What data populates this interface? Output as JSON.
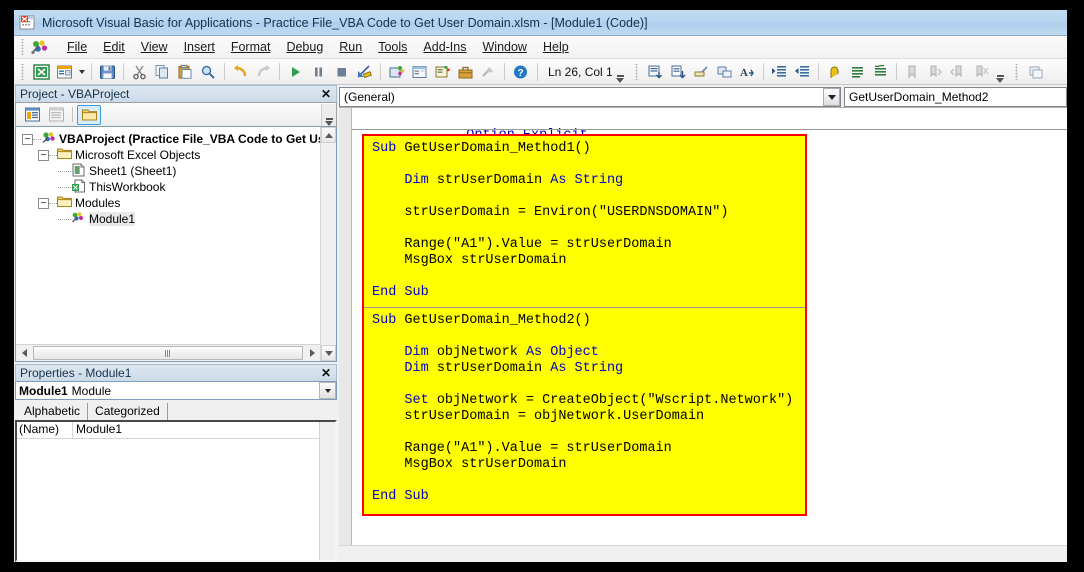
{
  "window": {
    "title": "Microsoft Visual Basic for Applications - Practice File_VBA Code to Get User Domain.xlsm - [Module1 (Code)]",
    "app_icon": "vba-excel-icon"
  },
  "menu": {
    "items": [
      {
        "label": "File",
        "accel": "F"
      },
      {
        "label": "Edit",
        "accel": "E"
      },
      {
        "label": "View",
        "accel": "V"
      },
      {
        "label": "Insert",
        "accel": "I"
      },
      {
        "label": "Format",
        "accel": "o"
      },
      {
        "label": "Debug",
        "accel": "D"
      },
      {
        "label": "Run",
        "accel": "R"
      },
      {
        "label": "Tools",
        "accel": "T"
      },
      {
        "label": "Add-Ins",
        "accel": "A"
      },
      {
        "label": "Window",
        "accel": "W"
      },
      {
        "label": "Help",
        "accel": "H"
      }
    ]
  },
  "toolbar": {
    "buttons": [
      "view-excel-icon",
      "insert-userform-icon",
      "save-icon",
      "cut-icon",
      "copy-icon",
      "paste-icon",
      "find-icon",
      "undo-icon",
      "redo-icon",
      "run-icon",
      "break-icon",
      "reset-icon",
      "design-mode-icon",
      "project-explorer-icon",
      "properties-window-icon",
      "object-browser-icon",
      "toolbox-icon",
      "help-icon"
    ],
    "status_text": "Ln 26, Col 1",
    "edit_buttons": [
      "list-properties-icon",
      "list-constants-icon",
      "quick-info-icon",
      "parameter-info-icon",
      "complete-word-icon",
      "indent-icon",
      "outdent-icon",
      "toggle-breakpoint-icon",
      "comment-block-icon",
      "uncomment-block-icon",
      "toggle-bookmark-icon",
      "next-bookmark-icon",
      "previous-bookmark-icon",
      "clear-bookmarks-icon"
    ]
  },
  "project_panel": {
    "caption": "Project - VBAProject",
    "close_label": "✕",
    "toolbar_buttons": [
      "view-code-icon",
      "view-object-icon",
      "toggle-folders-icon"
    ],
    "tree": [
      {
        "level": 0,
        "label": "VBAProject (Practice File_VBA Code to Get User I",
        "icon": "project-icon",
        "bold": true,
        "expander": "−",
        "selected": false
      },
      {
        "level": 1,
        "label": "Microsoft Excel Objects",
        "icon": "folder-icon",
        "bold": false,
        "expander": "−",
        "selected": false
      },
      {
        "level": 2,
        "label": "Sheet1 (Sheet1)",
        "icon": "worksheet-icon",
        "bold": false,
        "expander": "",
        "selected": false
      },
      {
        "level": 2,
        "label": "ThisWorkbook",
        "icon": "workbook-icon",
        "bold": false,
        "expander": "",
        "selected": false
      },
      {
        "level": 1,
        "label": "Modules",
        "icon": "folder-icon",
        "bold": false,
        "expander": "−",
        "selected": false
      },
      {
        "level": 2,
        "label": "Module1",
        "icon": "module-icon",
        "bold": false,
        "expander": "",
        "selected": true
      }
    ]
  },
  "properties_panel": {
    "caption": "Properties - Module1",
    "close_label": "✕",
    "object_name": "Module1",
    "object_type": "Module",
    "tabs": [
      {
        "label": "Alphabetic",
        "active": true
      },
      {
        "label": "Categorized",
        "active": false
      }
    ],
    "rows": [
      {
        "key": "(Name)",
        "value": "Module1"
      }
    ]
  },
  "code_window": {
    "object_combo": "(General)",
    "procedure_combo": "GetUserDomain_Method2",
    "header_lines": [
      [
        {
          "t": "Option Explicit",
          "k": true
        }
      ]
    ],
    "highlight": {
      "border_color": "#ff0000",
      "background_color": "#ffff00",
      "block1": [
        [
          {
            "t": "Sub",
            "k": true
          },
          {
            "t": " GetUserDomain_Method1()",
            "k": false
          }
        ],
        [
          {
            "t": "",
            "k": false
          }
        ],
        [
          {
            "t": "    Dim",
            "k": true
          },
          {
            "t": " strUserDomain ",
            "k": false
          },
          {
            "t": "As String",
            "k": true
          }
        ],
        [
          {
            "t": "",
            "k": false
          }
        ],
        [
          {
            "t": "    strUserDomain = Environ(\"USERDNSDOMAIN\")",
            "k": false
          }
        ],
        [
          {
            "t": "",
            "k": false
          }
        ],
        [
          {
            "t": "    Range(\"A1\").Value = strUserDomain",
            "k": false
          }
        ],
        [
          {
            "t": "    MsgBox strUserDomain",
            "k": false
          }
        ],
        [
          {
            "t": "",
            "k": false
          }
        ],
        [
          {
            "t": "End Sub",
            "k": true
          }
        ]
      ],
      "block2": [
        [
          {
            "t": "Sub",
            "k": true
          },
          {
            "t": " GetUserDomain_Method2()",
            "k": false
          }
        ],
        [
          {
            "t": "",
            "k": false
          }
        ],
        [
          {
            "t": "    Dim",
            "k": true
          },
          {
            "t": " objNetwork ",
            "k": false
          },
          {
            "t": "As Object",
            "k": true
          }
        ],
        [
          {
            "t": "    Dim",
            "k": true
          },
          {
            "t": " strUserDomain ",
            "k": false
          },
          {
            "t": "As String",
            "k": true
          }
        ],
        [
          {
            "t": "",
            "k": false
          }
        ],
        [
          {
            "t": "    Set",
            "k": true
          },
          {
            "t": " objNetwork = CreateObject(\"Wscript.Network\")",
            "k": false
          }
        ],
        [
          {
            "t": "    strUserDomain = objNetwork.UserDomain",
            "k": false
          }
        ],
        [
          {
            "t": "",
            "k": false
          }
        ],
        [
          {
            "t": "    Range(\"A1\").Value = strUserDomain",
            "k": false
          }
        ],
        [
          {
            "t": "    MsgBox strUserDomain",
            "k": false
          }
        ],
        [
          {
            "t": "",
            "k": false
          }
        ],
        [
          {
            "t": "End Sub",
            "k": true
          }
        ]
      ]
    }
  },
  "colors": {
    "keyword": "#0000c0",
    "plain": "#000000",
    "highlight_bg": "#ffff00",
    "highlight_border": "#ff0000",
    "titlebar": "#b7d4ef"
  }
}
